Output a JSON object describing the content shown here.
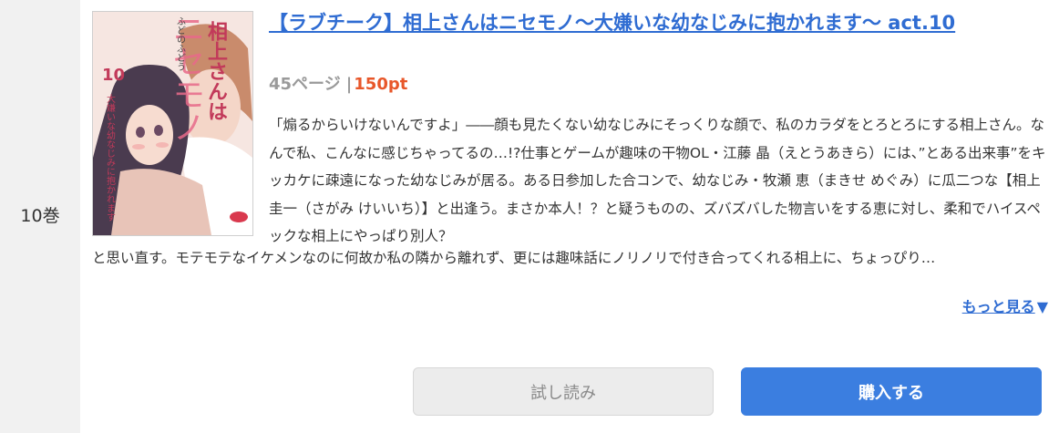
{
  "volume": {
    "label": "10巻"
  },
  "book": {
    "title": "【ラブチーク】相上さんはニセモノ～大嫌いな幼なじみに抱かれます～ act.10",
    "pages": "45ページ",
    "separator": "|",
    "price": "150pt",
    "cover_alt": "相上さんはニセモノ 表紙",
    "cover_text": {
      "title_vertical": "相上さんは",
      "title_big": "ニセモノ",
      "author": "ふどのふどう",
      "volume_number": "10",
      "subtitle": "大嫌いな幼なじみに抱かれます"
    },
    "description_top": "「煽るからいけないんですよ」――顔も見たくない幼なじみにそっくりな顔で、私のカラダをとろとろにする相上さん。なんで私、こんなに感じちゃってるの…!?仕事とゲームが趣味の干物OL・江藤 晶（えとうあきら）には、”とある出来事”をキッカケに疎遠になった幼なじみが居る。ある日参加した合コンで、幼なじみ・牧瀬 恵（まきせ めぐみ）に瓜二つな【相上 圭一（さがみ けいいち）】と出逢う。まさか本人！？と疑うものの、ズバズバした物言いをする恵に対し、柔和でハイスペックな相上にやっぱり別人？",
    "description_bottom": "と思い直す。モテモテなイケメンなのに何故か私の隣から離れず、更には趣味話にノリノリで付き合ってくれる相上に、ちょっぴり…"
  },
  "actions": {
    "more_label": "もっと見る",
    "more_icon": "▼",
    "trial_label": "試し読み",
    "buy_label": "購入する"
  },
  "colors": {
    "link": "#2f6cd2",
    "price": "#e8572a",
    "buy_button": "#3b7ee0",
    "trial_button": "#ececec",
    "background": "#f1f1f1"
  }
}
